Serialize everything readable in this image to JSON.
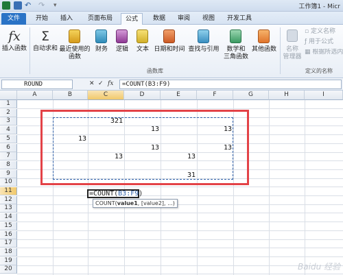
{
  "window": {
    "title": "工作簿1 - Micr"
  },
  "tabs": [
    {
      "label": "文件"
    },
    {
      "label": "开始"
    },
    {
      "label": "插入"
    },
    {
      "label": "页面布局"
    },
    {
      "label": "公式"
    },
    {
      "label": "数据"
    },
    {
      "label": "审阅"
    },
    {
      "label": "视图"
    },
    {
      "label": "开发工具"
    }
  ],
  "ribbon": {
    "insert_function": "插入函数",
    "autosum": "自动求和",
    "recent_1": "最近使用的",
    "recent_2": "函数",
    "financial": "财务",
    "logical": "逻辑",
    "text": "文本",
    "datetime": "日期和时间",
    "lookup": "查找与引用",
    "math_1": "数学和",
    "math_2": "三角函数",
    "other": "其他函数",
    "name_mgr_1": "名称",
    "name_mgr_2": "管理器",
    "define_name": "定义名称",
    "use_in_formula": "用于公式",
    "create_from_sel": "根据所选内容",
    "group_library": "函数库",
    "group_names": "定义的名称"
  },
  "formula_bar": {
    "name_box": "ROUND",
    "fx": "fx",
    "formula": "=COUNT(B3:F9)"
  },
  "columns": [
    "A",
    "B",
    "C",
    "D",
    "E",
    "F",
    "G",
    "H",
    "I"
  ],
  "rows": [
    "1",
    "2",
    "3",
    "4",
    "5",
    "6",
    "7",
    "8",
    "9",
    "10",
    "11",
    "12",
    "13",
    "14",
    "15",
    "16",
    "17",
    "18",
    "19",
    "20"
  ],
  "cells": {
    "C3": "321",
    "D4": "13",
    "F4": "13",
    "B5": "13",
    "D6": "13",
    "F6": "13",
    "C7": "13",
    "E7": "13",
    "E9": "31"
  },
  "active_cell": {
    "prefix": "=COUNT(",
    "ref": "B3:F9",
    "suffix": ")"
  },
  "tooltip": {
    "fn": "COUNT(",
    "arg1": "value1",
    "rest": ", [value2], ...)"
  },
  "watermark": "Baidu 经验"
}
